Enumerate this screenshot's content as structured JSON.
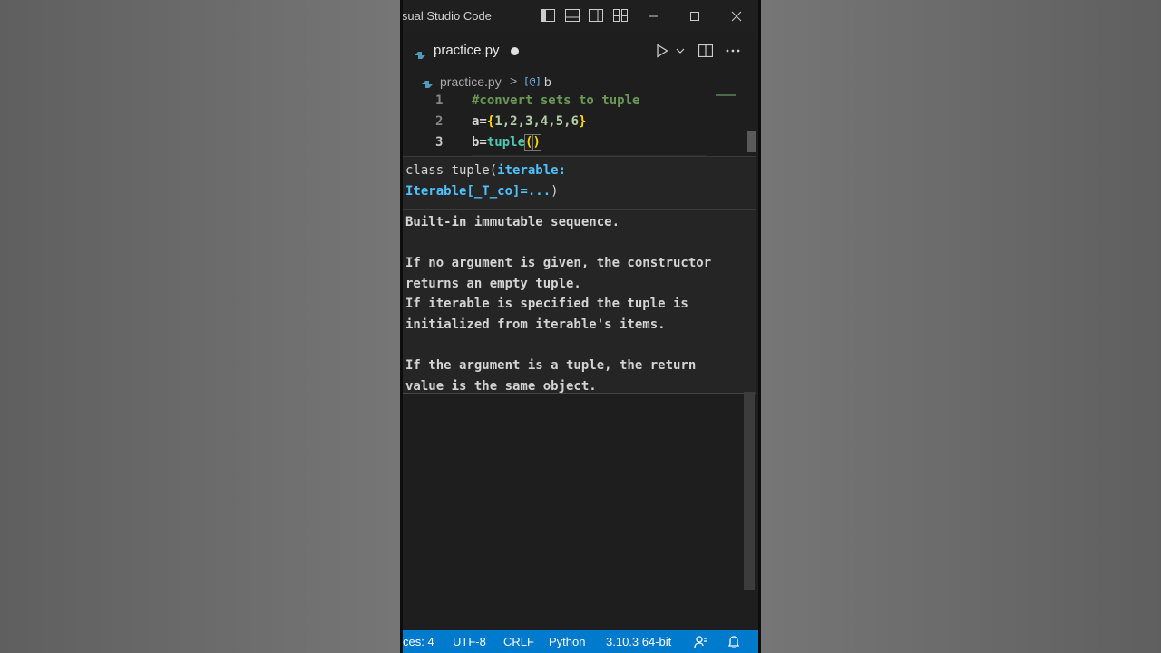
{
  "window": {
    "app_title": "Visual Studio Code",
    "title_visible": "isual Studio Code"
  },
  "tab": {
    "filename": "practice.py",
    "modified": true
  },
  "breadcrumb": {
    "file": "practice.py",
    "separator": ">",
    "symbol_icon": "[@]",
    "symbol": "b"
  },
  "editor": {
    "lines": [
      {
        "number": "1",
        "text": "#convert sets to tuple"
      },
      {
        "number": "2",
        "text": "a={1,2,3,4,5,6}"
      },
      {
        "number": "3",
        "text": "b=tuple()"
      }
    ],
    "active_line": 3
  },
  "hover": {
    "signature_line1_prefix": "class tuple(",
    "signature_param_1": "iterable:",
    "signature_param_2": "Iterable[_T_co]=...",
    "signature_suffix": ")",
    "doc": [
      "Built-in immutable sequence.",
      "",
      "If no argument is given, the constructor",
      "returns an empty tuple.",
      "If iterable is specified the tuple is",
      "initialized from iterable's items.",
      "",
      "If the argument is a tuple, the return",
      "value is the same object."
    ]
  },
  "statusbar": {
    "indent": "ces: 4",
    "encoding": "UTF-8",
    "eol": "CRLF",
    "language": "Python",
    "interpreter": "3.10.3 64-bit"
  },
  "colors": {
    "status_bar": "#007acc",
    "editor_bg": "#1e1e1e",
    "comment": "#6a9955",
    "function": "#4ec9b0",
    "param": "#4fc1ff",
    "brace": "#ffd700"
  },
  "icons": [
    "toggle-primary-sidebar-icon",
    "toggle-panel-icon",
    "toggle-secondary-sidebar-icon",
    "customize-layout-icon",
    "minimize-icon",
    "maximize-icon",
    "close-icon",
    "python-file-icon",
    "run-icon",
    "chevron-down-icon",
    "split-editor-icon",
    "more-actions-icon",
    "feedback-icon",
    "bell-icon"
  ]
}
